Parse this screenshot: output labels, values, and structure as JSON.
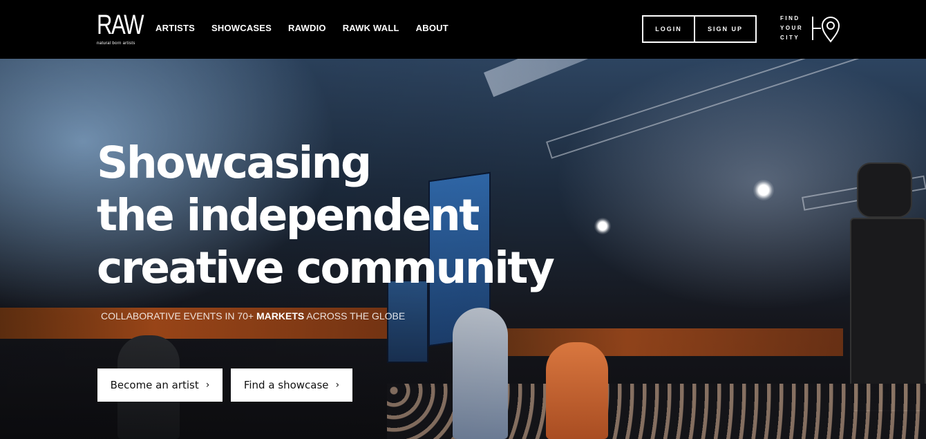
{
  "header": {
    "logo": {
      "word": "RAW",
      "tagline": "natural born artists"
    },
    "nav": [
      {
        "label": "ARTISTS"
      },
      {
        "label": "SHOWCASES"
      },
      {
        "label": "RAWDIO"
      },
      {
        "label": "RAWK WALL"
      },
      {
        "label": "ABOUT"
      }
    ],
    "login_label": "LOGIN",
    "signup_label": "SIGN UP",
    "find_city": {
      "line1": "FIND",
      "line2": "YOUR",
      "line3": "CITY"
    },
    "icons": {
      "location": "map-pin-icon"
    }
  },
  "hero": {
    "headline": {
      "line1": "Showcasing",
      "line2": "the independent",
      "line3": "creative community"
    },
    "subline": {
      "before": "COLLABORATIVE EVENTS IN 70+ ",
      "bold": "MARKETS",
      "after": " ACROSS THE GLOBE"
    },
    "cta_artist": "Become an artist",
    "cta_showcase": "Find a showcase",
    "chevron": "›"
  },
  "colors": {
    "header_bg": "#000000",
    "text": "#ffffff",
    "button_bg": "#ffffff",
    "button_text": "#111111"
  }
}
